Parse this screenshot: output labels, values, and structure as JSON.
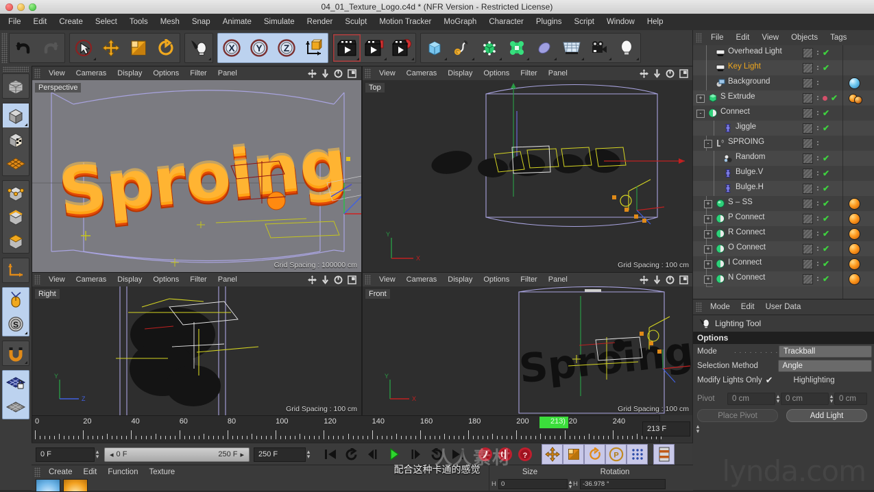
{
  "window": {
    "title": "04_01_Texture_Logo.c4d * (NFR Version - Restricted License)",
    "traffic": [
      "close",
      "minimize",
      "zoom"
    ]
  },
  "menubar": {
    "items": [
      "File",
      "Edit",
      "Create",
      "Select",
      "Tools",
      "Mesh",
      "Snap",
      "Animate",
      "Simulate",
      "Render",
      "Sculpt",
      "Motion Tracker",
      "MoGraph",
      "Character",
      "Plugins",
      "Script",
      "Window",
      "Help"
    ]
  },
  "toolbar": {
    "groups": [
      {
        "name": "history",
        "buttons": [
          {
            "icon": "undo-icon",
            "label": "Undo"
          },
          {
            "icon": "redo-icon",
            "label": "Redo"
          }
        ]
      },
      {
        "name": "transform",
        "buttons": [
          {
            "icon": "select-live-icon",
            "label": "Live Selection"
          },
          {
            "icon": "move-icon",
            "label": "Move"
          },
          {
            "icon": "scale-icon",
            "label": "Scale"
          },
          {
            "icon": "rotate-icon",
            "label": "Rotate"
          }
        ]
      },
      {
        "name": "light-tool",
        "buttons": [
          {
            "icon": "lighting-tool-icon",
            "label": "Lighting Tool"
          }
        ]
      },
      {
        "name": "axis-locks",
        "buttons": [
          {
            "icon": "axis-x-icon",
            "label": "X"
          },
          {
            "icon": "axis-y-icon",
            "label": "Y"
          },
          {
            "icon": "axis-z-icon",
            "label": "Z"
          },
          {
            "icon": "world-object-axis-icon",
            "label": "World/Object"
          }
        ]
      },
      {
        "name": "render",
        "buttons": [
          {
            "icon": "render-view-icon",
            "label": "Render View"
          },
          {
            "icon": "render-to-picture-icon",
            "label": "Render to Picture Viewer"
          },
          {
            "icon": "render-settings-icon",
            "label": "Edit Render Settings"
          }
        ]
      },
      {
        "name": "create",
        "buttons": [
          {
            "icon": "cube-primitive-icon",
            "label": "Cube"
          },
          {
            "icon": "spline-pen-icon",
            "label": "Spline"
          },
          {
            "icon": "generator-icon",
            "label": "Generators"
          },
          {
            "icon": "deformer-icon",
            "label": "Deformers"
          },
          {
            "icon": "scene-object-icon",
            "label": "Environment"
          },
          {
            "icon": "floor-icon",
            "label": "Floor"
          },
          {
            "icon": "camera-icon",
            "label": "Camera"
          },
          {
            "icon": "light-icon",
            "label": "Light"
          }
        ]
      }
    ]
  },
  "left_toolbar": {
    "buttons": [
      {
        "icon": "make-editable-icon",
        "label": "Make Editable"
      },
      {
        "icon": "model-mode-icon",
        "label": "Model Mode"
      },
      {
        "icon": "texture-mode-icon",
        "label": "Texture Mode"
      },
      {
        "icon": "polygon-grid-icon",
        "label": "Workplane"
      },
      {
        "icon": "point-mode-icon",
        "label": "Points"
      },
      {
        "icon": "edge-mode-icon",
        "label": "Edges"
      },
      {
        "icon": "polygon-mode-icon",
        "label": "Polygons"
      },
      {
        "icon": "axis-modify-icon",
        "label": "Enable Axis"
      },
      {
        "icon": "viewport-solo-icon",
        "label": "Viewport Solo"
      },
      {
        "icon": "snap-s-icon",
        "label": "Enable Snapping"
      },
      {
        "icon": "magnet-icon",
        "label": "Magnet"
      },
      {
        "icon": "workplane-lock-icon",
        "label": "Lock Workplane"
      },
      {
        "icon": "workplane-icon",
        "label": "Planar Workplane"
      }
    ]
  },
  "viewports": {
    "menu": [
      "View",
      "Cameras",
      "Display",
      "Options",
      "Filter",
      "Panel"
    ],
    "icons": [
      "pan-icon",
      "dolly-icon",
      "rotate-view-icon",
      "maximize-icon"
    ],
    "panels": [
      {
        "label": "Perspective",
        "grid": "Grid Spacing : 100000 cm"
      },
      {
        "label": "Top",
        "grid": "Grid Spacing : 100 cm"
      },
      {
        "label": "Right",
        "grid": "Grid Spacing : 100 cm"
      },
      {
        "label": "Front",
        "grid": "Grid Spacing : 100 cm"
      }
    ]
  },
  "object_manager": {
    "menu": [
      "File",
      "Edit",
      "View",
      "Objects",
      "Tags"
    ],
    "rows": [
      {
        "name": "Overhead Light",
        "indent": 1,
        "icon": "light-object-icon",
        "icon_color": "#e9e9e9",
        "expand": "",
        "visible": true,
        "dot": "",
        "material": false
      },
      {
        "name": "Key Light",
        "indent": 1,
        "icon": "light-object-icon",
        "icon_color": "#e9e9e9",
        "expand": "",
        "visible": true,
        "dot": "",
        "material": false,
        "selected": true
      },
      {
        "name": "Background",
        "indent": 1,
        "icon": "background-object-icon",
        "icon_color": "#9fc6e8",
        "expand": "",
        "visible": false,
        "dot": "",
        "material": "blue"
      },
      {
        "name": "S Extrude",
        "indent": 0,
        "icon": "extrude-icon",
        "icon_color": "#2fd07a",
        "expand": "+",
        "visible": true,
        "dot": "red",
        "material": "orange-small"
      },
      {
        "name": "Connect",
        "indent": 0,
        "icon": "connect-icon",
        "icon_color": "#2fd07a",
        "expand": "-",
        "visible": true,
        "dot": "",
        "material": false
      },
      {
        "name": "Jiggle",
        "indent": 2,
        "icon": "deformer-object-icon",
        "icon_color": "#7b7be0",
        "expand": "",
        "visible": true,
        "dot": "",
        "material": false
      },
      {
        "name": "SPROING",
        "indent": 1,
        "icon": "text-spline-icon",
        "icon_color": "#cfcfcf",
        "expand": "-",
        "visible": false,
        "dot": "",
        "material": false
      },
      {
        "name": "Random",
        "indent": 2,
        "icon": "random-effector-icon",
        "icon_color": "#9fc6e8",
        "expand": "",
        "visible": true,
        "dot": "",
        "material": false
      },
      {
        "name": "Bulge.V",
        "indent": 2,
        "icon": "bulge-icon",
        "icon_color": "#7b7be0",
        "expand": "",
        "visible": true,
        "dot": "",
        "material": false
      },
      {
        "name": "Bulge.H",
        "indent": 2,
        "icon": "bulge-icon",
        "icon_color": "#7b7be0",
        "expand": "",
        "visible": true,
        "dot": "",
        "material": false
      },
      {
        "name": "S – SS",
        "indent": 1,
        "icon": "sweep-icon",
        "icon_color": "#2fd07a",
        "expand": "+",
        "visible": true,
        "dot": "",
        "material": "orange"
      },
      {
        "name": "P Connect",
        "indent": 1,
        "icon": "connect-icon",
        "icon_color": "#2fd07a",
        "expand": "+",
        "visible": true,
        "dot": "",
        "material": "orange"
      },
      {
        "name": "R Connect",
        "indent": 1,
        "icon": "connect-icon",
        "icon_color": "#2fd07a",
        "expand": "+",
        "visible": true,
        "dot": "",
        "material": "orange"
      },
      {
        "name": "O Connect",
        "indent": 1,
        "icon": "connect-icon",
        "icon_color": "#2fd07a",
        "expand": "+",
        "visible": true,
        "dot": "",
        "material": "orange"
      },
      {
        "name": "I Connect",
        "indent": 1,
        "icon": "connect-icon",
        "icon_color": "#2fd07a",
        "expand": "+",
        "visible": true,
        "dot": "",
        "material": "orange"
      },
      {
        "name": "N Connect",
        "indent": 1,
        "icon": "connect-icon",
        "icon_color": "#2fd07a",
        "expand": "+",
        "visible": true,
        "dot": "",
        "material": "orange"
      }
    ]
  },
  "attributes": {
    "menu": [
      "Mode",
      "Edit",
      "User Data"
    ],
    "object": "Lighting Tool",
    "object_icon": "lighting-tool-icon",
    "section": "Options",
    "rows": [
      {
        "label": "Mode",
        "dots": ". . . . . . . . . .",
        "value": "Trackball",
        "type": "select"
      },
      {
        "label": "Selection Method",
        "dots": "",
        "value": "Angle",
        "type": "select"
      }
    ],
    "checkbox_label": "Modify Lights Only",
    "checkbox_checked": true,
    "checkbox2_label": "Highlighting",
    "pivot_label": "Pivot",
    "pivot_values": [
      "0 cm",
      "0 cm",
      "0 cm"
    ],
    "place_pivot_label": "Place Pivot",
    "add_light_label": "Add Light"
  },
  "timeline": {
    "ticks": [
      0,
      20,
      40,
      60,
      80,
      100,
      120,
      140,
      160,
      180,
      200,
      220,
      240
    ],
    "current_frame_label": "213)",
    "current_frame": 213,
    "range_start": 0,
    "range_end": 250,
    "field_value": "213 F"
  },
  "transport": {
    "current_field": "0 F",
    "range_left": "0 F",
    "range_right": "250 F",
    "end_field": "250 F",
    "buttons": [
      {
        "icon": "go-to-start-icon",
        "label": "Go to Start"
      },
      {
        "icon": "prev-key-icon",
        "label": "Go to Previous Key"
      },
      {
        "icon": "step-back-icon",
        "label": "Go to Previous Frame"
      },
      {
        "icon": "play-icon",
        "label": "Play Forwards"
      },
      {
        "icon": "step-forward-icon",
        "label": "Go to Next Frame"
      },
      {
        "icon": "next-key-icon",
        "label": "Go to Next Key"
      },
      {
        "icon": "go-to-end-icon",
        "label": "Go to End"
      },
      {
        "icon": "record-active-icon",
        "label": "Record Active Objects"
      },
      {
        "icon": "autokey-icon",
        "label": "Autokeying"
      },
      {
        "icon": "keyframe-selection-icon",
        "label": "Keyframe Selection"
      },
      {
        "icon": "key-position-icon",
        "label": "Position"
      },
      {
        "icon": "key-scale-icon",
        "label": "Scale"
      },
      {
        "icon": "key-rotation-icon",
        "label": "Rotation"
      },
      {
        "icon": "key-param-icon",
        "label": "Parameter"
      },
      {
        "icon": "key-pla-icon",
        "label": "Point Level Animation"
      },
      {
        "icon": "timeline-icon",
        "label": "Timeline"
      }
    ]
  },
  "material_manager": {
    "menu": [
      "Create",
      "Edit",
      "Function",
      "Texture"
    ],
    "swatches": [
      {
        "name": "sky-material",
        "color": "#6fb6e8"
      },
      {
        "name": "logo-material",
        "color": "#f2a01e"
      }
    ]
  },
  "coordinates": {
    "headers": [
      "Size",
      "Rotation"
    ],
    "rows": [
      {
        "axis": "H",
        "size": "0",
        "rotation": "-36.978 °"
      }
    ]
  },
  "overlay": {
    "subtitle": "配合这种卡通的感觉",
    "watermark": "lynda.com",
    "center_watermark": "人人素材"
  }
}
